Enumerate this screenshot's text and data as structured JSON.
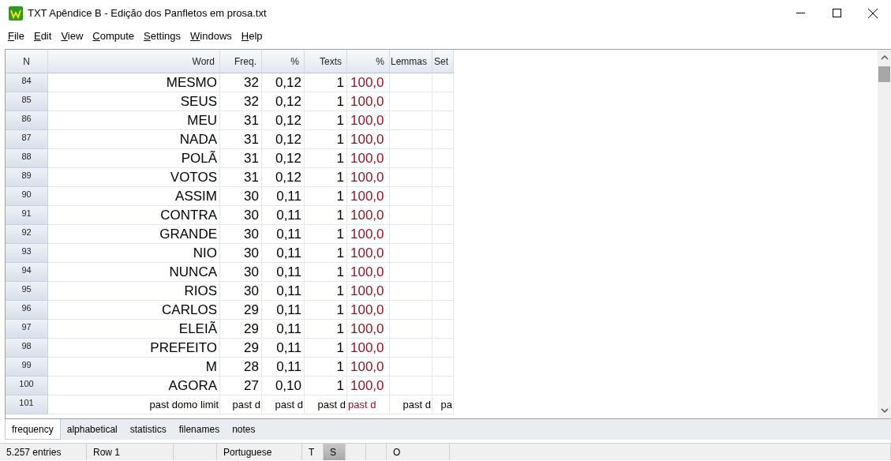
{
  "window": {
    "title": "TXT Apêndice B - Edição dos Panfletos em prosa.txt"
  },
  "menu": [
    "File",
    "Edit",
    "View",
    "Compute",
    "Settings",
    "Windows",
    "Help"
  ],
  "table": {
    "columns": [
      "N",
      "Word",
      "Freq.",
      "%",
      "Texts",
      "%",
      "Lemmas",
      "Set"
    ],
    "rows": [
      {
        "n": "84",
        "word": "MESMO",
        "freq": "32",
        "pct": "0,12",
        "texts": "1",
        "texts_pct": "100,0"
      },
      {
        "n": "85",
        "word": "SEUS",
        "freq": "32",
        "pct": "0,12",
        "texts": "1",
        "texts_pct": "100,0"
      },
      {
        "n": "86",
        "word": "MEU",
        "freq": "31",
        "pct": "0,12",
        "texts": "1",
        "texts_pct": "100,0"
      },
      {
        "n": "87",
        "word": "NADA",
        "freq": "31",
        "pct": "0,12",
        "texts": "1",
        "texts_pct": "100,0"
      },
      {
        "n": "88",
        "word": "POLÃ",
        "freq": "31",
        "pct": "0,12",
        "texts": "1",
        "texts_pct": "100,0"
      },
      {
        "n": "89",
        "word": "VOTOS",
        "freq": "31",
        "pct": "0,12",
        "texts": "1",
        "texts_pct": "100,0"
      },
      {
        "n": "90",
        "word": "ASSIM",
        "freq": "30",
        "pct": "0,11",
        "texts": "1",
        "texts_pct": "100,0"
      },
      {
        "n": "91",
        "word": "CONTRA",
        "freq": "30",
        "pct": "0,11",
        "texts": "1",
        "texts_pct": "100,0"
      },
      {
        "n": "92",
        "word": "GRANDE",
        "freq": "30",
        "pct": "0,11",
        "texts": "1",
        "texts_pct": "100,0"
      },
      {
        "n": "93",
        "word": "NIO",
        "freq": "30",
        "pct": "0,11",
        "texts": "1",
        "texts_pct": "100,0"
      },
      {
        "n": "94",
        "word": "NUNCA",
        "freq": "30",
        "pct": "0,11",
        "texts": "1",
        "texts_pct": "100,0"
      },
      {
        "n": "95",
        "word": "RIOS",
        "freq": "30",
        "pct": "0,11",
        "texts": "1",
        "texts_pct": "100,0"
      },
      {
        "n": "96",
        "word": "CARLOS",
        "freq": "29",
        "pct": "0,11",
        "texts": "1",
        "texts_pct": "100,0"
      },
      {
        "n": "97",
        "word": "ELEIÃ",
        "freq": "29",
        "pct": "0,11",
        "texts": "1",
        "texts_pct": "100,0"
      },
      {
        "n": "98",
        "word": "PREFEITO",
        "freq": "29",
        "pct": "0,11",
        "texts": "1",
        "texts_pct": "100,0"
      },
      {
        "n": "99",
        "word": "M",
        "freq": "28",
        "pct": "0,11",
        "texts": "1",
        "texts_pct": "100,0"
      },
      {
        "n": "100",
        "word": "AGORA",
        "freq": "27",
        "pct": "0,10",
        "texts": "1",
        "texts_pct": "100,0"
      },
      {
        "n": "101",
        "word": "past domo limit",
        "freq": "past d",
        "pct": "past d",
        "texts": "past d",
        "texts_pct": "past d",
        "lemmas": "past d",
        "set": "pa"
      }
    ]
  },
  "tabs": [
    {
      "label": "frequency",
      "selected": true
    },
    {
      "label": "alphabetical",
      "selected": false
    },
    {
      "label": "statistics",
      "selected": false
    },
    {
      "label": "filenames",
      "selected": false
    },
    {
      "label": "notes",
      "selected": false
    }
  ],
  "status_bar": [
    {
      "text": "5.257 entries",
      "pressed": false
    },
    {
      "text": "Row 1",
      "pressed": false
    },
    {
      "pressed": false
    },
    {
      "text": "Portuguese",
      "pressed": false
    },
    {
      "text": "T",
      "pressed": false
    },
    {
      "text": "S",
      "pressed": true
    },
    {
      "pressed": false
    },
    {
      "pressed": false
    },
    {
      "text": "O",
      "pressed": false
    },
    {
      "pressed": false
    }
  ]
}
